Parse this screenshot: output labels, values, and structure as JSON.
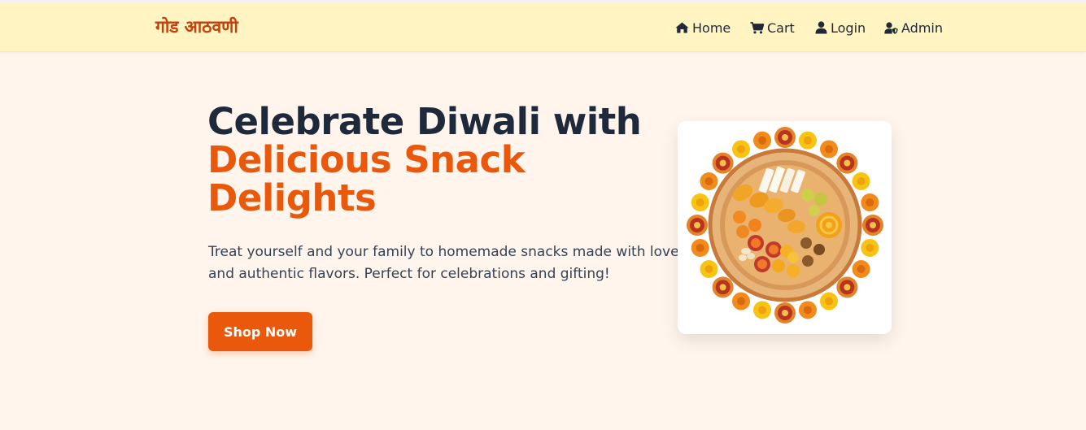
{
  "brand": "गोड आठवणी",
  "nav": {
    "home": "Home",
    "cart": "Cart",
    "login": "Login",
    "admin": "Admin"
  },
  "hero": {
    "title_line1": "Celebrate Diwali with",
    "title_line2": "Delicious Snack Delights",
    "description": "Treat yourself and your family to homemade snacks made with love and authentic flavors. Perfect for celebrations and gifting!",
    "cta": "Shop Now"
  },
  "colors": {
    "accent": "#ea580c",
    "navbar_bg": "#fff4c2",
    "page_bg": "#fff5ec",
    "brand": "#c2410c",
    "heading": "#1e293b"
  },
  "icons": {
    "home": "home-icon",
    "cart": "cart-icon",
    "login": "user-icon",
    "admin": "user-shield-icon"
  }
}
